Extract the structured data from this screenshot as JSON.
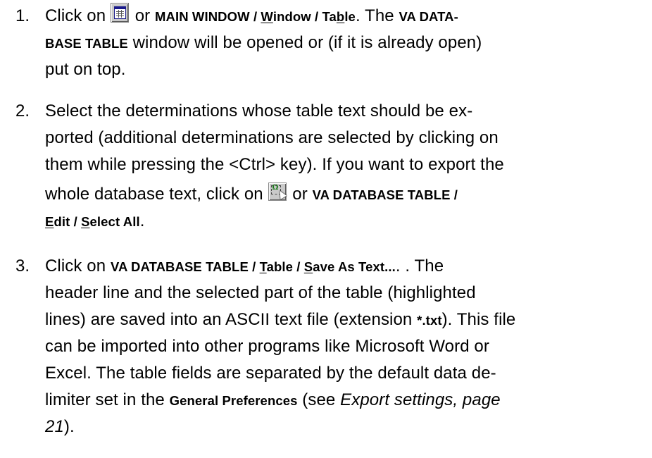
{
  "steps": [
    {
      "number": "1.",
      "line1": {
        "t1": "Click on ",
        "icon": "table-window-icon",
        "t2": " or ",
        "ui1": "MAIN WINDOW / ",
        "ui1_ul": "W",
        "ui1_rest": "indow / Ta",
        "ui1_ul2": "b",
        "ui1_end": "le",
        "t3": ". The ",
        "ui2": "VA DATA-"
      },
      "line2": {
        "ui": "BASE TABLE",
        "t": " window will be opened or (if it is already open)"
      },
      "line3": {
        "t": "put on top."
      }
    },
    {
      "number": "2.",
      "line1": {
        "t": "Select the determinations whose table text should be ex-"
      },
      "line2": {
        "t": "ported (additional determinations are selected by clicking on"
      },
      "line3": {
        "t": "them while pressing the <Ctrl> key). If you want to export the"
      },
      "line4": {
        "t1": "whole database text, click on ",
        "icon": "select-all-icon",
        "t2": " or ",
        "ui": "VA DATABASE TABLE /"
      },
      "line5": {
        "ul1": "E",
        "r1": "dit / ",
        "ul2": "S",
        "r2": "elect All",
        "t": "."
      }
    },
    {
      "number": "3.",
      "line1": {
        "t1": "Click on ",
        "ui1": "VA DATABASE TABLE / ",
        "ul1": "T",
        "r1": "able / ",
        "ul2": "S",
        "r2": "ave As Text...",
        "t2": ". . The"
      },
      "line2": {
        "t": "header line and the selected part of the table (highlighted"
      },
      "line3": {
        "t1": "lines) are saved into an ASCII text file (extension ",
        "ui": "*.txt",
        "t2": "). This file"
      },
      "line4": {
        "t": "can be imported into other programs like Microsoft Word or"
      },
      "line5": {
        "t": "Excel. The table fields are separated by the default data de-"
      },
      "line6": {
        "t1": "limiter set in the ",
        "ui": "General Preferences",
        "t2": " (see ",
        "em": "Export settings, page"
      },
      "line7": {
        "em": "21",
        "t": ")."
      }
    }
  ]
}
